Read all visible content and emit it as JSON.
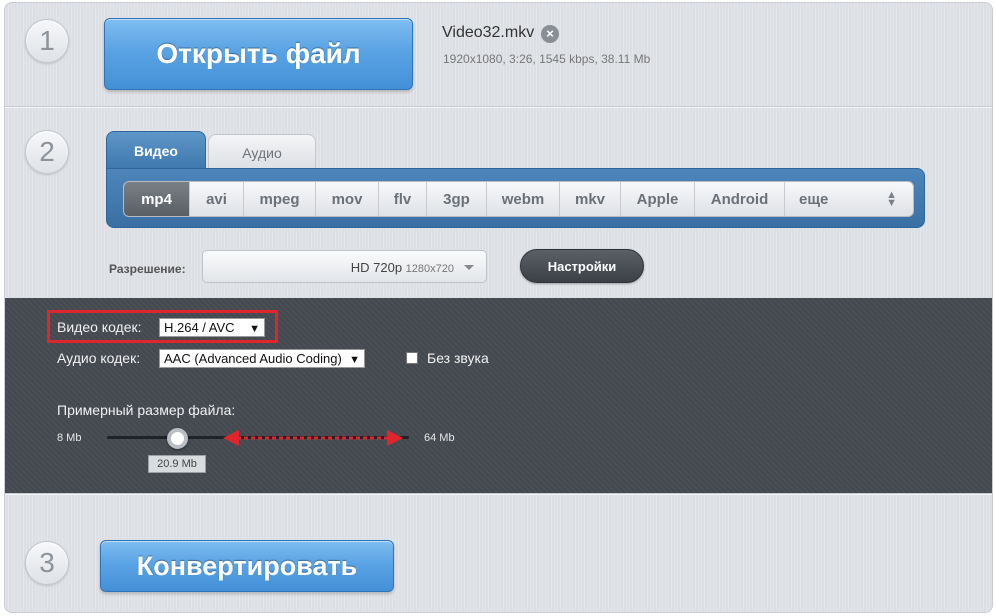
{
  "steps": [
    "1",
    "2",
    "3"
  ],
  "open_file": {
    "label": "Открыть файл"
  },
  "file": {
    "name": "Video32.mkv",
    "info": "1920x1080, 3:26, 1545 kbps, 38.11 Mb",
    "remove_icon": "close-circle-icon"
  },
  "tabs": [
    {
      "label": "Видео",
      "active": true
    },
    {
      "label": "Аудио",
      "active": false
    }
  ],
  "formats": [
    {
      "label": "mp4",
      "active": true
    },
    {
      "label": "avi"
    },
    {
      "label": "mpeg"
    },
    {
      "label": "mov"
    },
    {
      "label": "flv"
    },
    {
      "label": "3gp"
    },
    {
      "label": "webm"
    },
    {
      "label": "mkv"
    },
    {
      "label": "Apple"
    },
    {
      "label": "Android"
    },
    {
      "label": "еще"
    }
  ],
  "resolution": {
    "label": "Разрешение:",
    "value": "HD 720p",
    "dims": "1280x720"
  },
  "settings_button": "Настройки",
  "video_codec": {
    "label": "Видео кодек:",
    "value": "H.264 / AVC"
  },
  "audio_codec": {
    "label": "Аудио кодек:",
    "value": "AAC (Advanced Audio Coding)"
  },
  "no_sound": {
    "label": "Без звука",
    "checked": false
  },
  "file_size": {
    "label": "Примерный размер файла:",
    "min": "8 Mb",
    "max": "64 Mb",
    "current": "20.9 Mb"
  },
  "convert": {
    "label": "Конвертировать"
  },
  "colors": {
    "accent": "#4a90d9",
    "highlight": "#e0262c",
    "arrow": "#e0262c"
  }
}
